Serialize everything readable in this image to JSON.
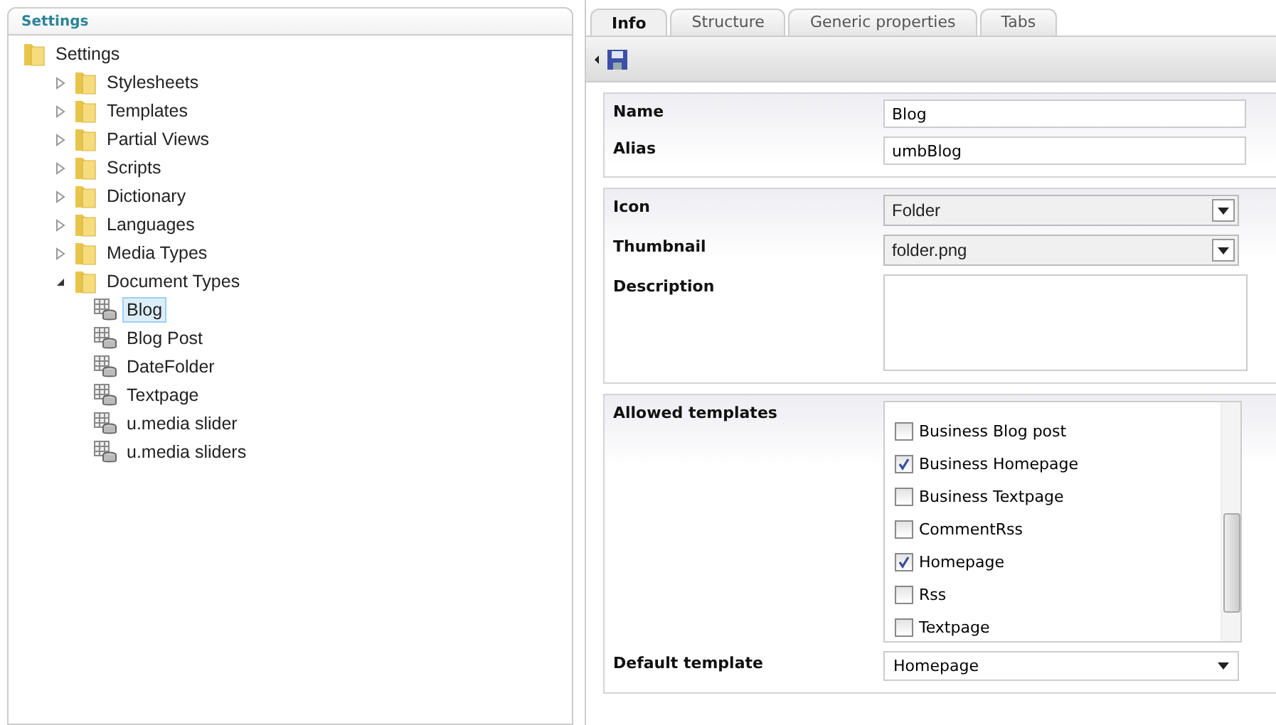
{
  "sidebar": {
    "title": "Settings",
    "tree": {
      "label": "Settings",
      "children": [
        {
          "label": "Stylesheets",
          "kind": "folder",
          "expanded": false,
          "selected": false
        },
        {
          "label": "Templates",
          "kind": "folder",
          "expanded": false,
          "selected": false
        },
        {
          "label": "Partial Views",
          "kind": "folder",
          "expanded": false,
          "selected": false
        },
        {
          "label": "Scripts",
          "kind": "folder",
          "expanded": false,
          "selected": false
        },
        {
          "label": "Dictionary",
          "kind": "folder",
          "expanded": false,
          "selected": false
        },
        {
          "label": "Languages",
          "kind": "folder",
          "expanded": false,
          "selected": false
        },
        {
          "label": "Media Types",
          "kind": "folder",
          "expanded": false,
          "selected": false
        },
        {
          "label": "Document Types",
          "kind": "folder",
          "expanded": true,
          "selected": false,
          "children": [
            {
              "label": "Blog",
              "kind": "doctype",
              "selected": true
            },
            {
              "label": "Blog Post",
              "kind": "doctype",
              "selected": false
            },
            {
              "label": "DateFolder",
              "kind": "doctype",
              "selected": false
            },
            {
              "label": "Textpage",
              "kind": "doctype",
              "selected": false
            },
            {
              "label": "u.media slider",
              "kind": "doctype",
              "selected": false
            },
            {
              "label": "u.media sliders",
              "kind": "doctype",
              "selected": false
            }
          ]
        }
      ]
    }
  },
  "tabs": [
    {
      "label": "Info",
      "selected": true
    },
    {
      "label": "Structure",
      "selected": false
    },
    {
      "label": "Generic properties",
      "selected": false
    },
    {
      "label": "Tabs",
      "selected": false
    }
  ],
  "sections": [
    {
      "fields": [
        {
          "label": "Name",
          "kind": "text",
          "value": "Blog"
        },
        {
          "label": "Alias",
          "kind": "text",
          "value": "umbBlog"
        }
      ]
    },
    {
      "fields": [
        {
          "label": "Icon",
          "kind": "select",
          "value": "Folder"
        },
        {
          "label": "Thumbnail",
          "kind": "select",
          "value": "folder.png"
        },
        {
          "label": "Description",
          "kind": "textarea"
        }
      ]
    },
    {
      "fields": [
        {
          "label": "Allowed templates",
          "kind": "checklist",
          "options": [
            {
              "label": "Business Blog post",
              "checked": false
            },
            {
              "label": "Business Homepage",
              "checked": true
            },
            {
              "label": "Business Textpage",
              "checked": false
            },
            {
              "label": "CommentRss",
              "checked": false
            },
            {
              "label": "Homepage",
              "checked": true
            },
            {
              "label": "Rss",
              "checked": false
            },
            {
              "label": "Textpage",
              "checked": false
            }
          ]
        },
        {
          "label": "Default template",
          "kind": "dropdown",
          "value": "Homepage"
        }
      ]
    }
  ]
}
